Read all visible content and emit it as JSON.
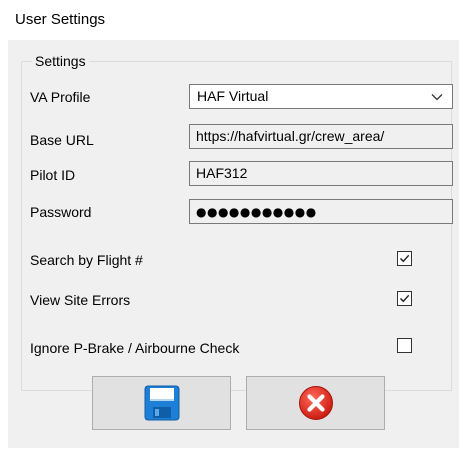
{
  "window": {
    "title": "User Settings"
  },
  "settings_group": {
    "legend": "Settings",
    "fields": {
      "va_profile": {
        "label": "VA Profile",
        "value": "HAF Virtual"
      },
      "base_url": {
        "label": "Base URL",
        "value": "https://hafvirtual.gr/crew_area/"
      },
      "pilot_id": {
        "label": "Pilot ID",
        "value": "HAF312"
      },
      "password": {
        "label": "Password",
        "value": "●●●●●●●●●●●"
      }
    },
    "checkboxes": {
      "search_by_flight": {
        "label": "Search by Flight #",
        "checked": true
      },
      "view_site_errors": {
        "label": "View Site Errors",
        "checked": true
      },
      "ignore_pbrake": {
        "label": "Ignore P-Brake / Airbourne Check",
        "checked": false
      }
    }
  },
  "buttons": {
    "save": {
      "icon": "floppy-disk-icon"
    },
    "cancel": {
      "icon": "red-x-icon"
    }
  },
  "colors": {
    "panel_background": "#f0f0f0",
    "save_icon_blue": "#1d7fd6",
    "cancel_icon_red": "#e02b20"
  }
}
